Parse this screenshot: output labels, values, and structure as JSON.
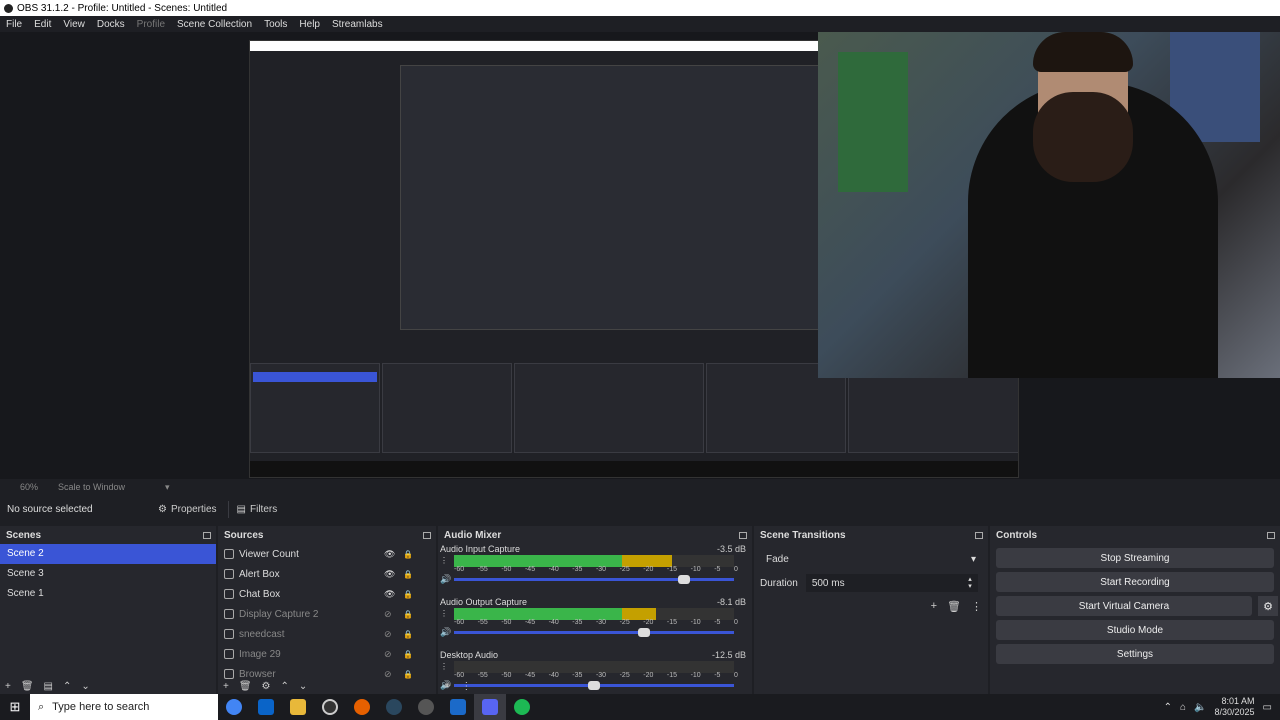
{
  "window": {
    "title": "OBS 31.1.2 - Profile: Untitled - Scenes: Untitled"
  },
  "menu": [
    "File",
    "Edit",
    "View",
    "Docks",
    "Profile",
    "Scene Collection",
    "Tools",
    "Help",
    "Streamlabs"
  ],
  "status": {
    "zoom": "60%",
    "scale_mode": "Scale to Window"
  },
  "context": {
    "no_source": "No source selected",
    "properties": "Properties",
    "filters": "Filters"
  },
  "docks": {
    "scenes": {
      "title": "Scenes",
      "items": [
        "Scene 2",
        "Scene 3",
        "Scene 1"
      ],
      "active": "Scene 2"
    },
    "sources": {
      "title": "Sources",
      "items": [
        {
          "label": "Viewer Count",
          "visible": true
        },
        {
          "label": "Alert Box",
          "visible": true
        },
        {
          "label": "Chat Box",
          "visible": true
        },
        {
          "label": "Display Capture 2",
          "visible": false
        },
        {
          "label": "sneedcast",
          "visible": false
        },
        {
          "label": "Image 29",
          "visible": false
        },
        {
          "label": "Browser",
          "visible": false
        }
      ]
    },
    "mixer": {
      "title": "Audio Mixer",
      "channels": [
        {
          "name": "Audio Input Capture",
          "db": "-3.5 dB",
          "level": 0.78,
          "volume": 0.82
        },
        {
          "name": "Audio Output Capture",
          "db": "-8.1 dB",
          "level": 0.72,
          "volume": 0.68
        },
        {
          "name": "Desktop Audio",
          "db": "-12.5 dB",
          "level": 0.0,
          "volume": 0.5
        }
      ],
      "scale": [
        "-60",
        "-55",
        "-50",
        "-45",
        "-40",
        "-35",
        "-30",
        "-25",
        "-20",
        "-15",
        "-10",
        "-5",
        "0"
      ]
    },
    "transitions": {
      "title": "Scene Transitions",
      "selected": "Fade",
      "duration_label": "Duration",
      "duration": "500 ms"
    },
    "controls": {
      "title": "Controls",
      "buttons": [
        "Stop Streaming",
        "Start Recording",
        "Start Virtual Camera",
        "Studio Mode",
        "Settings"
      ]
    }
  },
  "taskbar": {
    "search_placeholder": "Type here to search",
    "time": "8:01 AM",
    "date": "8/30/2025"
  },
  "colors": {
    "accent": "#3a55d6",
    "meter_green": "#3ab54a",
    "meter_yellow": "#c4a000"
  }
}
